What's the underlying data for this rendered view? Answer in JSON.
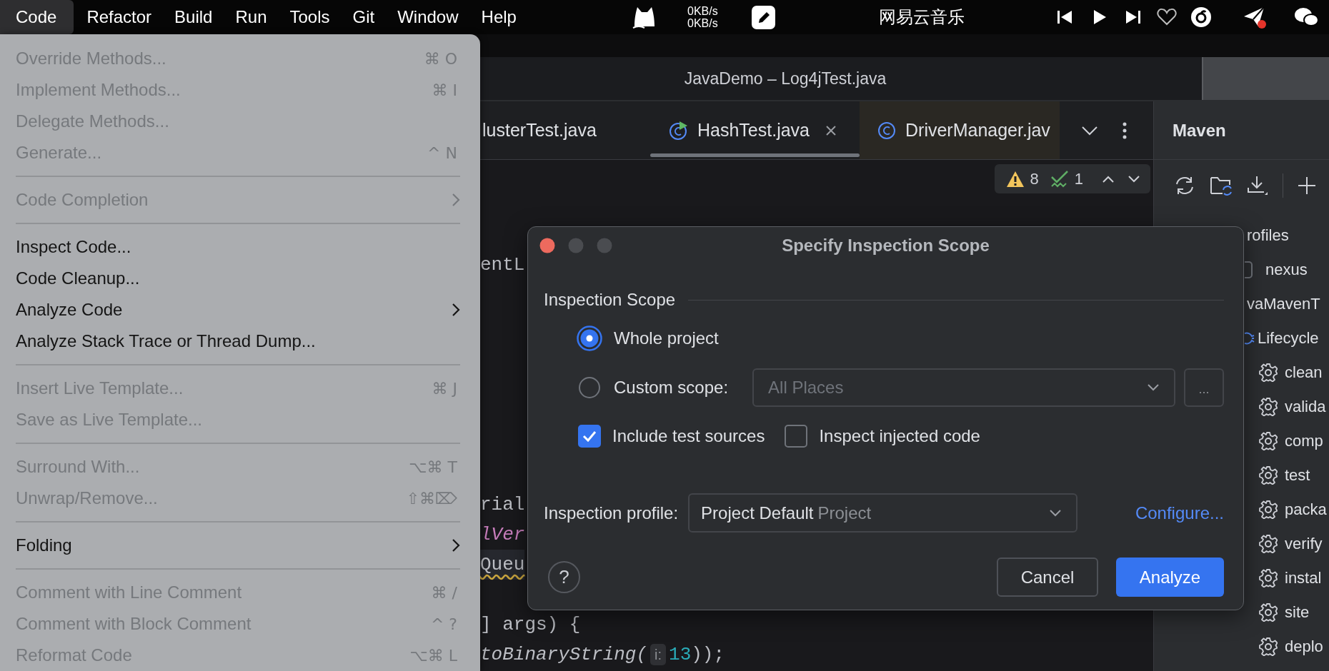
{
  "menubar": {
    "items": [
      {
        "label": "Code",
        "selected": true
      },
      {
        "label": "Refactor",
        "selected": false
      },
      {
        "label": "Build",
        "selected": false
      },
      {
        "label": "Run",
        "selected": false
      },
      {
        "label": "Tools",
        "selected": false
      },
      {
        "label": "Git",
        "selected": false
      },
      {
        "label": "Window",
        "selected": false
      },
      {
        "label": "Help",
        "selected": false
      }
    ],
    "network_speed": [
      "0KB/s",
      "0KB/s"
    ],
    "app_title": "网易云音乐"
  },
  "code_menu": {
    "items": [
      {
        "kind": "item",
        "label": "Override Methods...",
        "shortcut": "⌘ O",
        "disabled": true,
        "submenu": false
      },
      {
        "kind": "item",
        "label": "Implement Methods...",
        "shortcut": "⌘ I",
        "disabled": true,
        "submenu": false
      },
      {
        "kind": "item",
        "label": "Delegate Methods...",
        "disabled": true,
        "submenu": false
      },
      {
        "kind": "item",
        "label": "Generate...",
        "shortcut": "^ N",
        "disabled": true,
        "submenu": false
      },
      {
        "kind": "separator"
      },
      {
        "kind": "item",
        "label": "Code Completion",
        "disabled": true,
        "submenu": true
      },
      {
        "kind": "separator"
      },
      {
        "kind": "item",
        "label": "Inspect Code...",
        "disabled": false,
        "submenu": false
      },
      {
        "kind": "item",
        "label": "Code Cleanup...",
        "disabled": false,
        "submenu": false
      },
      {
        "kind": "item",
        "label": "Analyze Code",
        "disabled": false,
        "submenu": true
      },
      {
        "kind": "item",
        "label": "Analyze Stack Trace or Thread Dump...",
        "disabled": false,
        "submenu": false
      },
      {
        "kind": "separator"
      },
      {
        "kind": "item",
        "label": "Insert Live Template...",
        "shortcut": "⌘ J",
        "disabled": true,
        "submenu": false
      },
      {
        "kind": "item",
        "label": "Save as Live Template...",
        "disabled": true,
        "submenu": false
      },
      {
        "kind": "separator"
      },
      {
        "kind": "item",
        "label": "Surround With...",
        "shortcut": "⌥⌘ T",
        "disabled": true,
        "submenu": false
      },
      {
        "kind": "item",
        "label": "Unwrap/Remove...",
        "shortcut": "⇧⌘⌦",
        "disabled": true,
        "submenu": false
      },
      {
        "kind": "separator"
      },
      {
        "kind": "item",
        "label": "Folding",
        "disabled": false,
        "submenu": true
      },
      {
        "kind": "separator"
      },
      {
        "kind": "item",
        "label": "Comment with Line Comment",
        "shortcut": "⌘ /",
        "disabled": true,
        "submenu": false
      },
      {
        "kind": "item",
        "label": "Comment with Block Comment",
        "shortcut": "^ ?",
        "disabled": true,
        "submenu": false
      },
      {
        "kind": "item",
        "label": "Reformat Code",
        "shortcut": "⌥⌘ L",
        "disabled": true,
        "submenu": false
      }
    ]
  },
  "window": {
    "title": "JavaDemo – Log4jTest.java"
  },
  "editor_tabs": [
    {
      "label": "lusterTest.java",
      "selected": false,
      "closable": false
    },
    {
      "label": "HashTest.java",
      "kind": "class_run",
      "selected": true,
      "closable": true
    },
    {
      "label": "DriverManager.jav",
      "kind": "class",
      "selected": false,
      "closable": false
    }
  ],
  "problems": {
    "warnings": "8",
    "weak_warnings": "1"
  },
  "code_lines": [
    {
      "segments": [
        {
          "text": "entL",
          "kind": "plain"
        }
      ],
      "current": false,
      "warning": false
    },
    {
      "segments": [
        {
          "text": "rial",
          "kind": "plain"
        }
      ],
      "current": false,
      "warning": false
    },
    {
      "segments": [
        {
          "text": "lVer",
          "kind": "field"
        }
      ],
      "current": false,
      "warning": false
    },
    {
      "segments": [
        {
          "text": "Queu",
          "kind": "plain"
        }
      ],
      "current": true,
      "warning": true
    },
    {
      "segments": [
        {
          "text": "] args) {",
          "kind": "plain"
        }
      ],
      "current": false,
      "warning": false
    },
    {
      "segments": [
        {
          "text": "toBinaryString(",
          "kind": "static"
        },
        {
          "text": "i:",
          "kind": "hint"
        },
        {
          "text": "13",
          "kind": "number"
        },
        {
          "text": "));",
          "kind": "plain"
        }
      ],
      "current": false,
      "warning": false
    }
  ],
  "maven": {
    "title": "Maven",
    "tree": [
      {
        "label": "rofiles",
        "children": [
          {
            "label": "nexus",
            "kind": "profile",
            "checked": false
          }
        ]
      },
      {
        "label": "vaMavenT",
        "children": [
          {
            "label": "Lifecycle",
            "kind": "lifecycle",
            "children": [
              {
                "label": "clean",
                "kind": "goal"
              },
              {
                "label": "valida",
                "kind": "goal"
              },
              {
                "label": "comp",
                "kind": "goal"
              },
              {
                "label": "test",
                "kind": "goal"
              },
              {
                "label": "packa",
                "kind": "goal"
              },
              {
                "label": "verify",
                "kind": "goal"
              },
              {
                "label": "instal",
                "kind": "goal"
              },
              {
                "label": "site",
                "kind": "goal"
              },
              {
                "label": "deplo",
                "kind": "goal"
              }
            ]
          }
        ]
      }
    ]
  },
  "dialog": {
    "title": "Specify Inspection Scope",
    "section": "Inspection Scope",
    "scopes": [
      {
        "label": "Whole project",
        "selected": true
      },
      {
        "label": "Custom scope:",
        "selected": false,
        "combo": {
          "value": "All Places",
          "disabled": true
        },
        "browse_button": "..."
      }
    ],
    "options": [
      {
        "label": "Include test sources",
        "checked": true
      },
      {
        "label": "Inspect injected code",
        "checked": false
      }
    ],
    "profile": {
      "label": "Inspection profile:",
      "value": "Project Default",
      "hint": "Project"
    },
    "link": "Configure...",
    "help_button": "?",
    "buttons": [
      {
        "label": "Cancel",
        "kind": "secondary"
      },
      {
        "label": "Analyze",
        "kind": "primary"
      }
    ]
  }
}
